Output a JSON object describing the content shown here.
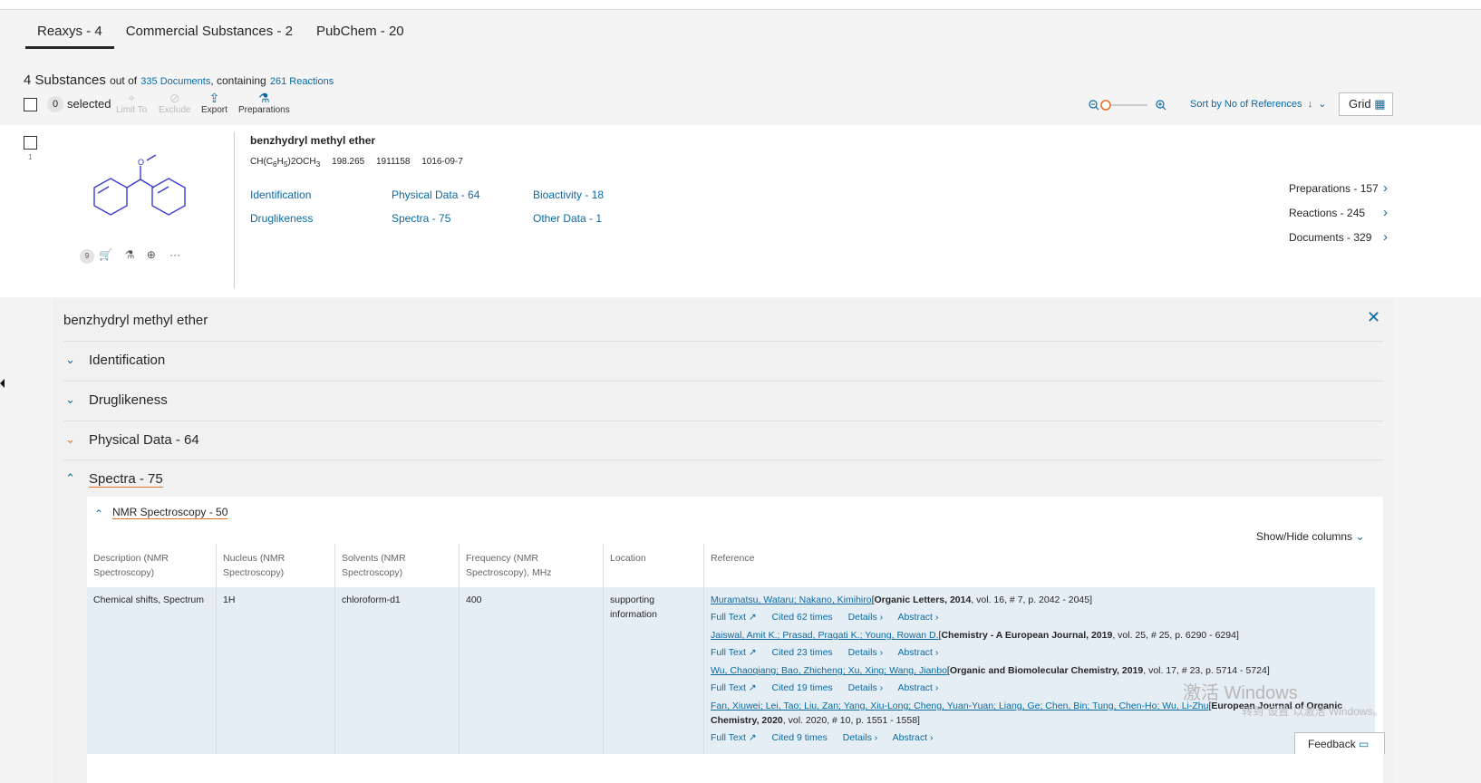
{
  "tabs": [
    {
      "label": "Reaxys - 4",
      "active": true
    },
    {
      "label": "Commercial Substances - 2",
      "active": false
    },
    {
      "label": "PubChem - 20",
      "active": false
    }
  ],
  "summary": {
    "count_label": "4 Substances",
    "out_of": "out of",
    "documents_link": "335 Documents",
    "containing": ", containing",
    "reactions_link": "261 Reactions"
  },
  "toolbar": {
    "selected_count": "0",
    "selected_label": "selected",
    "limit_to": "Limit To",
    "exclude": "Exclude",
    "export": "Export",
    "preparations": "Preparations",
    "sort_label": "Sort by No of References",
    "grid_label": "Grid"
  },
  "hit": {
    "index": "1",
    "title": "benzhydryl methyl ether",
    "formula": "CH(C6H5)2OCH3",
    "mw": "198.265",
    "reaxys_id": "1911158",
    "cas": "1016-09-7",
    "links": {
      "identification": "Identification",
      "druglikeness": "Druglikeness",
      "physical_data": "Physical Data - 64",
      "spectra": "Spectra - 75",
      "bioactivity": "Bioactivity - 18",
      "other_data": "Other Data - 1"
    },
    "right_links": {
      "preparations": "Preparations - 157",
      "reactions": "Reactions - 245",
      "documents": "Documents - 329"
    },
    "badge": "9",
    "more": "···"
  },
  "detail": {
    "title": "benzhydryl methyl ether",
    "sections": {
      "identification": "Identification",
      "druglikeness": "Druglikeness",
      "physical_data": "Physical Data - 64",
      "spectra": "Spectra - 75"
    },
    "nmr_label": "NMR Spectroscopy - 50",
    "show_hide": "Show/Hide columns",
    "columns": [
      "Description (NMR Spectroscopy)",
      "Nucleus (NMR Spectroscopy)",
      "Solvents (NMR Spectroscopy)",
      "Frequency (NMR Spectroscopy), MHz",
      "Location",
      "Reference"
    ],
    "row": {
      "description": "Chemical shifts, Spectrum",
      "nucleus": "1H",
      "solvent": "chloroform-d1",
      "frequency": "400",
      "location": "supporting information"
    },
    "references": [
      {
        "authors": "Muramatsu, Wataru; Nakano, Kimihiro",
        "journal": "Organic Letters, 2014",
        "details": ", vol. 16, # 7, p. 2042 - 2045]",
        "cited": "Cited 62 times"
      },
      {
        "authors": "Jaiswal, Amit K.; Prasad, Pragati K.; Young, Rowan D.",
        "journal": "Chemistry - A European Journal, 2019",
        "details": ", vol. 25, # 25, p. 6290 - 6294]",
        "cited": "Cited 23 times"
      },
      {
        "authors": "Wu, Chaoqiang; Bao, Zhicheng; Xu, Xing; Wang, Jianbo",
        "journal": "Organic and Biomolecular Chemistry, 2019",
        "details": ", vol. 17, # 23, p. 5714 - 5724]",
        "cited": "Cited 19 times"
      },
      {
        "authors": "Fan, Xiuwei; Lei, Tao; Liu, Zan; Yang, Xiu-Long; Cheng, Yuan-Yuan; Liang, Ge; Chen, Bin; Tung, Chen-Ho; Wu, Li-Zhu",
        "journal": "European Journal of Organic Chemistry, 2020",
        "details": ", vol. 2020, # 10, p. 1551 - 1558]",
        "cited": "Cited 9 times"
      }
    ],
    "full_text": "Full Text ↗",
    "details_link": "Details ›",
    "abstract_link": "Abstract ›"
  },
  "watermark": {
    "line1": "激活 Windows",
    "line2": "转到\"设置\"以激活 Windows。"
  },
  "feedback": "Feedback"
}
